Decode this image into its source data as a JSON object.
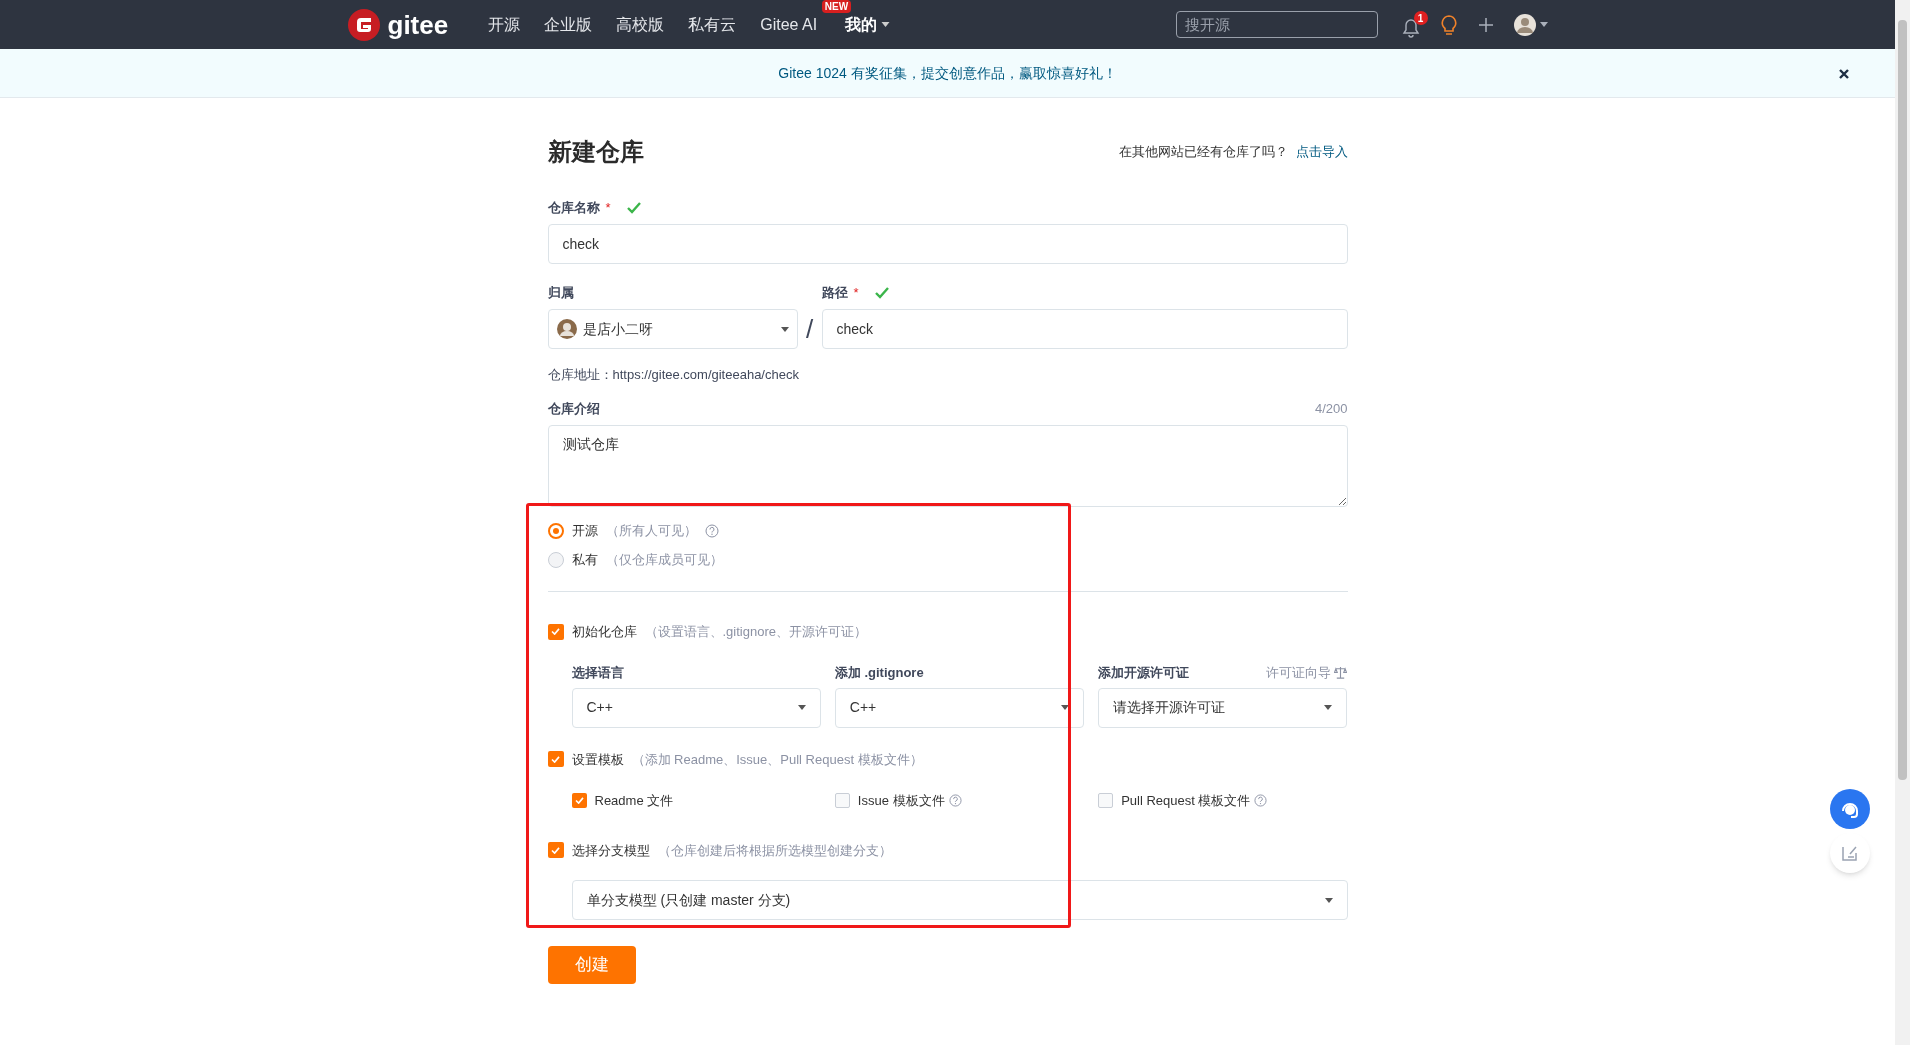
{
  "header": {
    "logo": "gitee",
    "nav": [
      {
        "label": "开源",
        "kind": "link"
      },
      {
        "label": "企业版",
        "kind": "link"
      },
      {
        "label": "高校版",
        "kind": "link"
      },
      {
        "label": "私有云",
        "kind": "link"
      },
      {
        "label": "Gitee AI",
        "kind": "badge",
        "badge": "NEW"
      },
      {
        "label": "我的",
        "kind": "dropdown"
      }
    ],
    "search": {
      "placeholder": "搜开源"
    },
    "notification_count": "1"
  },
  "banner": {
    "text": "Gitee 1024 有奖征集，提交创意作品，赢取惊喜好礼！"
  },
  "form": {
    "title": "新建仓库",
    "import_prompt": "在其他网站已经有仓库了吗？",
    "import_link": "点击导入",
    "name": {
      "label": "仓库名称",
      "required_mark": "*",
      "valid": true,
      "value": "check"
    },
    "owner": {
      "label": "归属",
      "value": "是店小二呀"
    },
    "separator": "/",
    "path": {
      "label": "路径",
      "required_mark": "*",
      "valid": true,
      "value": "check"
    },
    "address": "仓库地址：https://gitee.com/giteeaha/check",
    "description": {
      "label": "仓库介绍",
      "counter": "4/200",
      "value": "测试仓库"
    },
    "visibility": [
      {
        "label": "开源",
        "hint": "（所有人可见）",
        "selected": true,
        "help": true
      },
      {
        "label": "私有",
        "hint": "（仅仓库成员可见）",
        "selected": false,
        "help": false
      }
    ],
    "init": {
      "label": "初始化仓库",
      "hint": "（设置语言、.gitignore、开源许可证）",
      "checked": true
    },
    "init_fields": [
      {
        "label": "选择语言",
        "value": "C++"
      },
      {
        "label": "添加 .gitignore",
        "value": "C++"
      },
      {
        "label": "添加开源许可证",
        "value": "请选择开源许可证",
        "link": "许可证向导"
      }
    ],
    "template": {
      "label": "设置模板",
      "hint": "（添加 Readme、Issue、Pull Request 模板文件）",
      "checked": true
    },
    "template_files": [
      {
        "label": "Readme 文件",
        "checked": true,
        "help": false
      },
      {
        "label": "Issue 模板文件",
        "checked": false,
        "help": true
      },
      {
        "label": "Pull Request 模板文件",
        "checked": false,
        "help": true
      }
    ],
    "branch": {
      "label": "选择分支模型",
      "hint": "（仓库创建后将根据所选模型创建分支）",
      "checked": true,
      "value": "单分支模型 (只创建 master 分支)"
    },
    "submit": "创建"
  }
}
